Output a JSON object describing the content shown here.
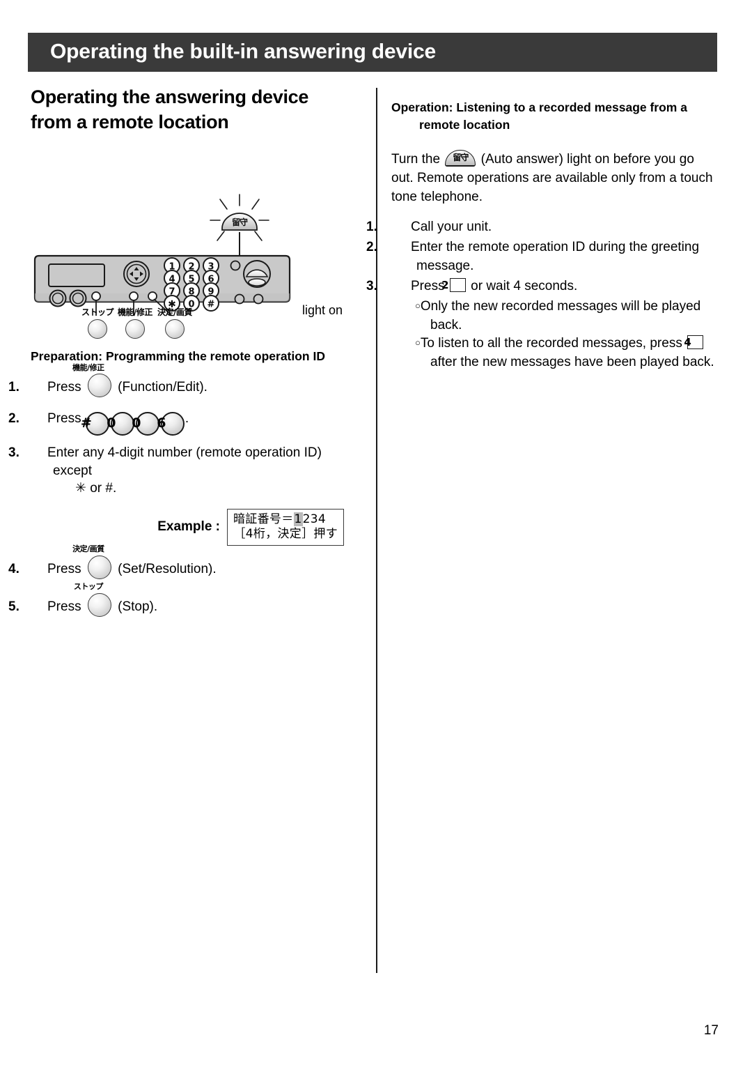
{
  "header": {
    "title": "Operating the built-in answering device",
    "bar_color": "#3a3a3a"
  },
  "left_column": {
    "section_title_line1": "Operating the answering device",
    "section_title_line2": "from a remote location",
    "figure": {
      "light_on_label": "light on",
      "auto_answer_glyph": "留守",
      "keypad_rows": [
        [
          "1",
          "2",
          "3"
        ],
        [
          "4",
          "5",
          "6"
        ],
        [
          "7",
          "8",
          "9"
        ],
        [
          "✳",
          "0",
          "#"
        ]
      ],
      "callouts": [
        {
          "jp": "ストップ"
        },
        {
          "jp": "機能/修正"
        },
        {
          "jp": "決定/画質"
        }
      ]
    },
    "preparation": {
      "heading": "Preparation: Programming the remote operation ID",
      "step1": {
        "num": "1.",
        "press": "Press",
        "button_caption": "機能/修正",
        "after": "(Function/Edit)."
      },
      "step2": {
        "num": "2.",
        "press": "Press",
        "keys": [
          "#",
          "0",
          "0",
          "6"
        ],
        "after": "."
      },
      "step3": {
        "num": "3.",
        "line1": "Enter any 4-digit number (remote operation ID) except",
        "line2": "✳ or #."
      },
      "example": {
        "label": "Example :",
        "lcd_line1_prefix": "暗証番号＝",
        "lcd_cursor": "1",
        "lcd_line1_suffix": "234",
        "lcd_line2": "［4桁，決定］押す"
      },
      "step4": {
        "num": "4.",
        "press": "Press",
        "button_caption": "決定/画質",
        "after": "(Set/Resolution)."
      },
      "step5": {
        "num": "5.",
        "press": "Press",
        "button_caption": "ストップ",
        "after": "(Stop)."
      }
    }
  },
  "right_column": {
    "heading_line1": "Operation: Listening to a recorded message from a",
    "heading_line2": "remote location",
    "intro_part1": "Turn the",
    "intro_icon_glyph": "留守",
    "intro_part2": "(Auto answer) light on before you go out. Remote operations are available only from a touch tone telephone.",
    "steps": [
      {
        "num": "1.",
        "text": "Call your unit."
      },
      {
        "num": "2.",
        "text": "Enter the remote operation ID during the greeting message."
      }
    ],
    "step3": {
      "num": "3.",
      "part1": "Press",
      "key": "2",
      "part2": "or wait 4 seconds."
    },
    "bullets": [
      {
        "marker": "○",
        "text": "Only the new recorded messages will be played back."
      }
    ],
    "bullet2": {
      "marker": "○",
      "part1": "To listen to all the recorded messages, press",
      "key": "4",
      "part2": "after the new messages have been played back."
    }
  },
  "footer": {
    "page_number": "17"
  }
}
